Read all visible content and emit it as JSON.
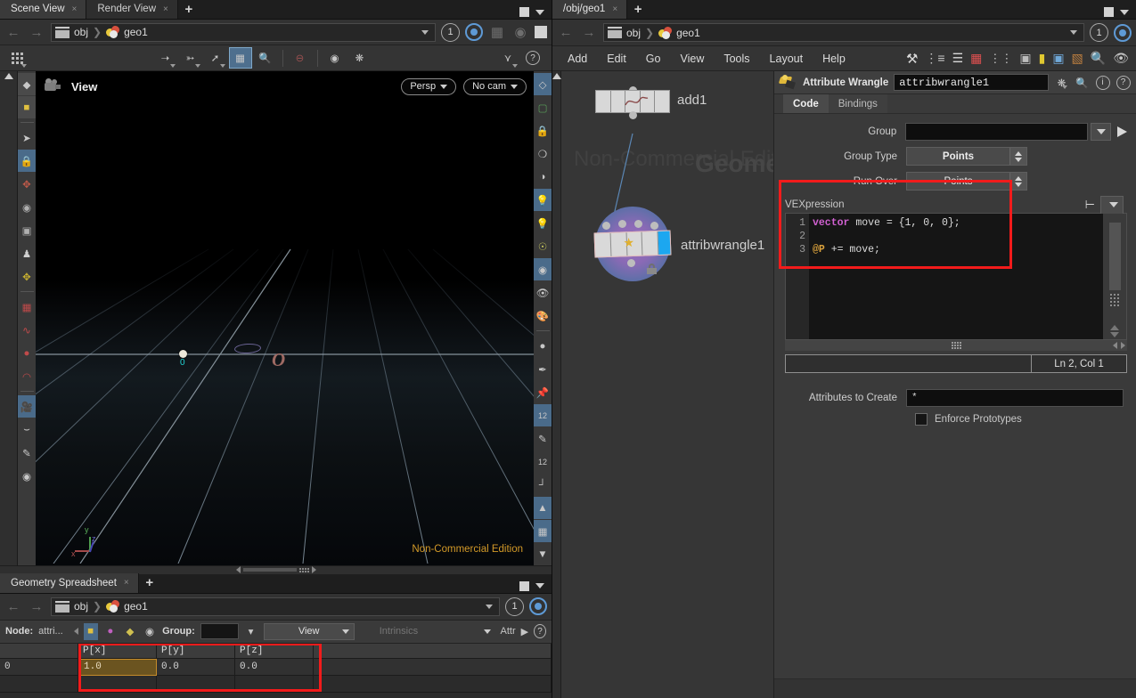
{
  "scene_pane": {
    "tabs": [
      {
        "label": "Scene View",
        "active": true,
        "close": "×"
      },
      {
        "label": "Render View",
        "active": false,
        "close": "×"
      }
    ],
    "add_tab": "+",
    "path": {
      "root": "obj",
      "node": "geo1",
      "separator": "❯",
      "frame": "1"
    },
    "toolbar_icons": [
      "grid-dots-icon",
      "select-tool-icon",
      "handle-tool-icon",
      "move-tool-icon",
      "snap-toggle-icon",
      "zoom-box-icon",
      "no-entry-icon",
      "animation-icon",
      "gear-star-icon",
      "node-tree-icon",
      "help-icon"
    ],
    "viewport": {
      "title": "View",
      "persp_label": "Persp",
      "camera_label": "No cam",
      "watermark": "Non-Commercial Edition",
      "point_label": "0",
      "axis_x": "x",
      "axis_y": "y",
      "axis_z": "z"
    },
    "view_tools": [
      "eye-display-icon",
      "select-geometry-icon",
      "lock-icon",
      "no-snap-icon",
      "ghost-icon",
      "light-bulb-icon",
      "point-light-icon",
      "area-light-icon",
      "material-sphere-icon",
      "hide-other-icon",
      "paint-icon",
      "point-icon",
      "pen-icon",
      "pin-icon",
      "num12-point-icon",
      "brush-icon",
      "num12-brush-icon",
      "measure-icon",
      "paper-plane-icon",
      "checker-icon",
      "collapse-icon"
    ],
    "left_tools": [
      "material-diamond-icon",
      "material-yellow-icon",
      "arrow-select-icon",
      "lock-handle-icon",
      "move-tool-icon",
      "rotate-tool-icon",
      "scale-tool-icon",
      "pose-tool-icon",
      "transform-axis-icon",
      "magnet-grid-icon",
      "magnet-curve-icon",
      "magnet-point-icon",
      "magnet-icon",
      "camera-icon",
      "arc-icon",
      "paint-tool-icon",
      "film-reel-icon"
    ]
  },
  "spreadsheet_pane": {
    "tabs": [
      {
        "label": "Geometry Spreadsheet",
        "active": true,
        "close": "×"
      }
    ],
    "add_tab": "+",
    "path": {
      "root": "obj",
      "node": "geo1",
      "separator": "❯",
      "frame": "1"
    },
    "toolbar": {
      "node_label": "Node:",
      "node_value": "attri...",
      "group_label": "Group:",
      "group_value": "",
      "view_select": "View",
      "intrinsics_select": "Intrinsics",
      "attr_label": "Attr",
      "attr_arrow": "▶"
    },
    "table": {
      "columns": [
        "",
        "P[x]",
        "P[y]",
        "P[z]",
        ""
      ],
      "rows": [
        [
          "0",
          "1.0",
          "0.0",
          "0.0",
          ""
        ]
      ],
      "highlight_cell": "1.0",
      "highlight_color": "#c58b2a"
    }
  },
  "network_pane": {
    "tabs": [
      {
        "label": "/obj/geo1",
        "active": true,
        "close": "×"
      }
    ],
    "add_tab": "+",
    "path": {
      "root": "obj",
      "node": "geo1",
      "separator": "❯",
      "frame": "1"
    },
    "menus": [
      "Add",
      "Edit",
      "Go",
      "View",
      "Tools",
      "Layout",
      "Help"
    ],
    "toolbar_icons": [
      "tools-wrench-icon",
      "hierarchy-icon",
      "list-icon",
      "color-palette-icon",
      "dots-grid-icon",
      "layout-icon",
      "sticky-note-icon",
      "image-add-icon",
      "box-icon",
      "search-icon",
      "eye-icon"
    ],
    "watermark": "Non-Commercial Edition",
    "context_label": "Geometry",
    "nodes": [
      {
        "name": "add1",
        "type": "add"
      },
      {
        "name": "attribwrangle1",
        "type": "attribwrangle",
        "locked": true
      }
    ]
  },
  "parameters": {
    "node_type_label": "Attribute Wrangle",
    "node_name": "attribwrangle1",
    "header_icons": [
      "gear-icon",
      "search-icon",
      "info-icon",
      "help-icon"
    ],
    "tabs": [
      {
        "label": "Code",
        "active": true
      },
      {
        "label": "Bindings",
        "active": false
      }
    ],
    "fields": {
      "group_label": "Group",
      "group_value": "",
      "group_type_label": "Group Type",
      "group_type_value": "Points",
      "run_over_label": "Run Over",
      "run_over_value": "Points",
      "vex_label": "VEXpression",
      "attributes_label": "Attributes to Create",
      "attributes_value": "*",
      "enforce_label": "Enforce Prototypes",
      "enforce_checked": false,
      "status_position": "Ln 2, Col 1"
    },
    "code": {
      "lines": [
        "1",
        "2",
        "3"
      ],
      "line1_keyword": "vector",
      "line1_rest": " move = {1, 0, 0};",
      "line2": "",
      "line3_at": "@P",
      "line3_rest": " += move;"
    },
    "highlight_color": "#f21b1b"
  }
}
